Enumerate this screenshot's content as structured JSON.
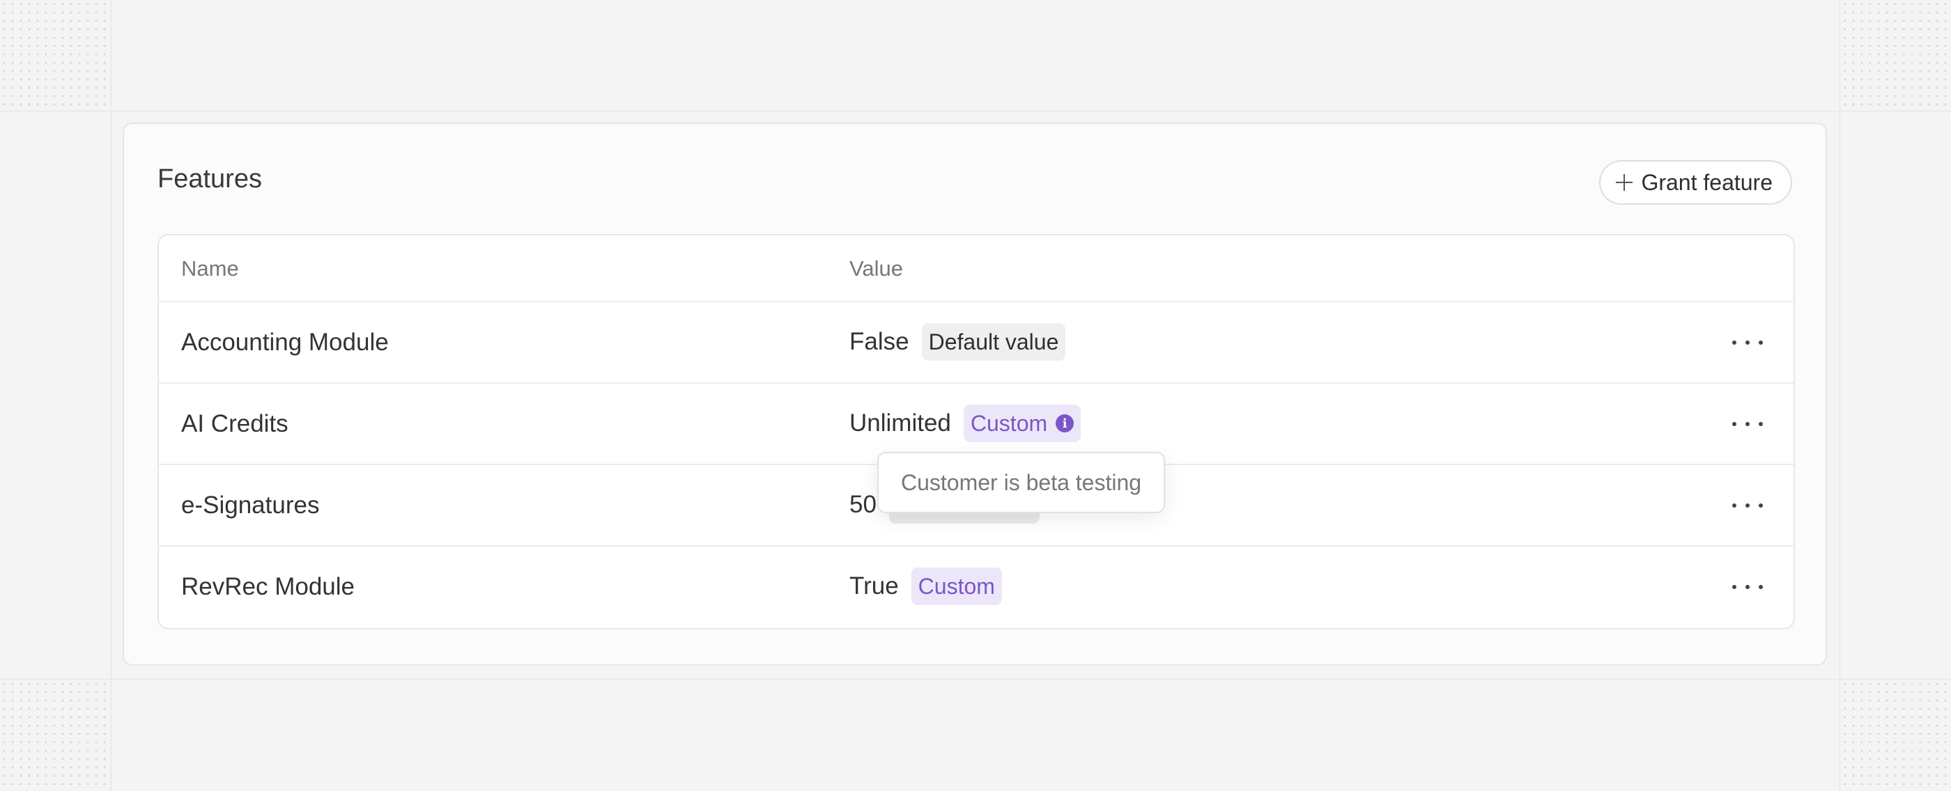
{
  "card": {
    "title": "Features",
    "grant_button_label": "Grant feature"
  },
  "table": {
    "columns": {
      "name": "Name",
      "value": "Value"
    },
    "rows": [
      {
        "name": "Accounting Module",
        "value": "False",
        "badge": "Default value",
        "badge_type": "default"
      },
      {
        "name": "AI Credits",
        "value": "Unlimited",
        "badge": "Custom",
        "badge_type": "custom",
        "badge_icon": "info-icon"
      },
      {
        "name": "e-Signatures",
        "value": "50",
        "badge": "",
        "badge_type": "hidden"
      },
      {
        "name": "RevRec Module",
        "value": "True",
        "badge": "Custom",
        "badge_type": "custom"
      }
    ]
  },
  "tooltip": {
    "text": "Customer is beta testing"
  },
  "colors": {
    "custom_badge_text": "#7b56c9",
    "custom_badge_bg": "#ece7f8",
    "default_badge_bg": "#efefef",
    "page_bg": "#f4f4f4"
  },
  "icons": {
    "grant_button": "plus-icon",
    "row_actions": "more-horizontal-icon",
    "custom_info": "info-icon"
  }
}
